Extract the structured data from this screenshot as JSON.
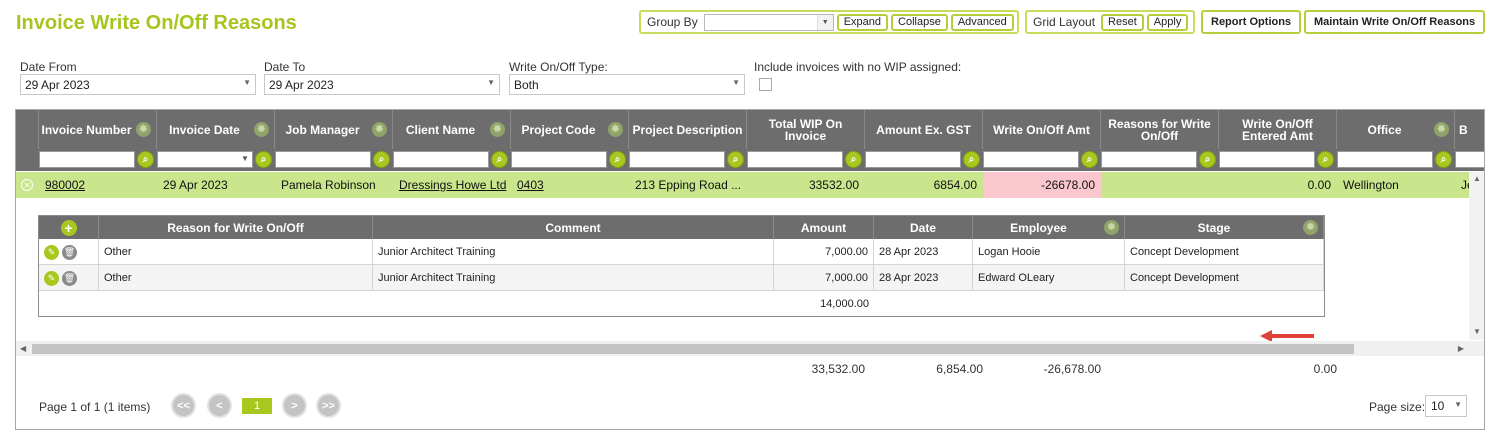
{
  "page": {
    "title": "Invoice Write On/Off Reasons"
  },
  "toolbar": {
    "group_by_label": "Group By",
    "group_by_value": "",
    "expand": "Expand",
    "collapse": "Collapse",
    "advanced": "Advanced",
    "grid_layout_label": "Grid Layout",
    "reset": "Reset",
    "apply": "Apply",
    "report_options": "Report Options",
    "maintain": "Maintain Write On/Off Reasons"
  },
  "filters": {
    "date_from_label": "Date From",
    "date_from_value": "29 Apr 2023",
    "date_to_label": "Date To",
    "date_to_value": "29 Apr 2023",
    "type_label": "Write On/Off Type:",
    "type_value": "Both",
    "include_label": "Include invoices with no WIP assigned:",
    "include_checked": false
  },
  "grid": {
    "columns": [
      "Invoice Number",
      "Invoice Date",
      "Job Manager",
      "Client Name",
      "Project Code",
      "Project Description",
      "Total WIP On Invoice",
      "Amount Ex. GST",
      "Write On/Off Amt",
      "Reasons for Write On/Off",
      "Write On/Off Entered Amt",
      "Office",
      "B"
    ],
    "row": {
      "invoice_number": "980002",
      "invoice_date": "29 Apr 2023",
      "job_manager": "Pamela Robinson",
      "client_name": "Dressings Howe Ltd",
      "project_code": "0403",
      "project_description": "213 Epping Road ...",
      "total_wip": "33532.00",
      "amount_ex_gst": "6854.00",
      "write_amt": "-26678.00",
      "reasons": "",
      "entered_amt": "0.00",
      "office": "Wellington",
      "b": "Je"
    },
    "detail": {
      "columns": [
        "Reason for Write On/Off",
        "Comment",
        "Amount",
        "Date",
        "Employee",
        "Stage"
      ],
      "rows": [
        {
          "reason": "Other",
          "comment": "Junior Architect Training",
          "amount": "7,000.00",
          "date": "28 Apr 2023",
          "employee": "Logan Hooie",
          "stage": "Concept Development"
        },
        {
          "reason": "Other",
          "comment": "Junior Architect Training",
          "amount": "7,000.00",
          "date": "28 Apr 2023",
          "employee": "Edward OLeary",
          "stage": "Concept Development"
        }
      ],
      "total_amount": "14,000.00"
    },
    "totals": {
      "total_wip": "33,532.00",
      "amount_ex_gst": "6,854.00",
      "write_amt": "-26,678.00",
      "entered_amt": "0.00"
    },
    "pager": {
      "info": "Page 1 of 1 (1 items)",
      "first": "<<",
      "prev": "<",
      "current": "1",
      "next": ">",
      "last": ">>",
      "page_size_label": "Page size:",
      "page_size": "10"
    }
  },
  "colors": {
    "accent": "#a6c51e",
    "header_bg": "#6d6d6d",
    "row_selected": "#c9e68d",
    "negative_bg": "#f9c7cd",
    "callout": "#e0403a"
  }
}
